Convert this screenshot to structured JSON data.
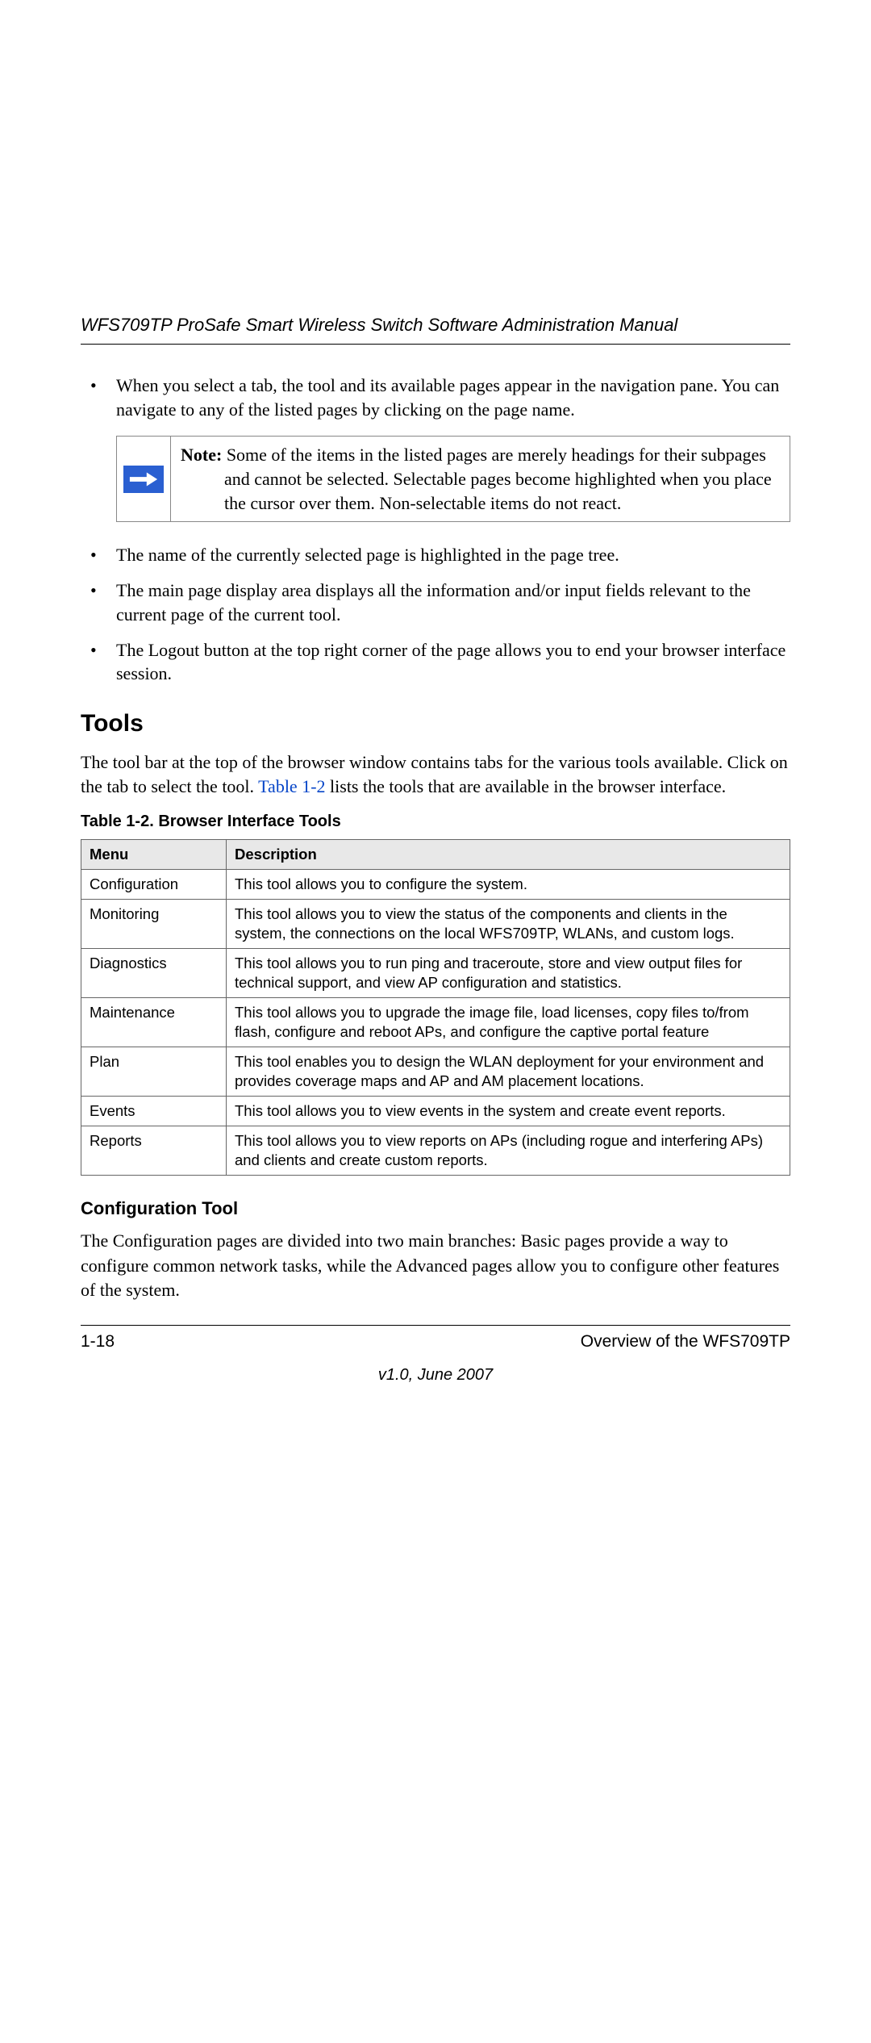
{
  "header": {
    "title": "WFS709TP ProSafe Smart Wireless Switch Software Administration Manual"
  },
  "bullets": {
    "b1": "When you select a tab, the tool and its available pages appear in the navigation pane. You can navigate to any of the listed pages by clicking on the page name.",
    "b2": "The name of the currently selected page is highlighted in the page tree.",
    "b3": "The main page display area displays all the information and/or input fields relevant to the current page of the current tool.",
    "b4": "The Logout button at the top right corner of the page allows you to end your browser interface session."
  },
  "note": {
    "label": "Note:",
    "line1": "Some of the items in the listed pages are merely headings for their subpages",
    "line2": "and cannot be selected. Selectable pages become highlighted when you place the cursor over them. Non-selectable items do not react."
  },
  "tools": {
    "heading": "Tools",
    "intro_a": "The tool bar at the top of the browser window contains tabs for the various tools available. Click on the tab to select the tool. ",
    "intro_link": "Table 1-2",
    "intro_b": " lists the tools that are available in the browser interface.",
    "table_caption": "Table 1-2.   Browser Interface Tools",
    "headers": {
      "menu": "Menu",
      "desc": "Description"
    },
    "rows": [
      {
        "menu": "Configuration",
        "desc": "This tool allows you to configure the system."
      },
      {
        "menu": "Monitoring",
        "desc": "This tool allows you to view the status of the components and clients in the system, the connections on the local WFS709TP, WLANs, and custom logs."
      },
      {
        "menu": "Diagnostics",
        "desc": "This tool allows you to run ping and traceroute, store and view output files for technical support, and view AP configuration and statistics."
      },
      {
        "menu": "Maintenance",
        "desc": "This tool allows you to upgrade the image file, load licenses, copy files to/from flash, configure and reboot APs, and configure the captive portal feature"
      },
      {
        "menu": "Plan",
        "desc": "This tool enables you to design the WLAN deployment for your environment and provides coverage maps and AP and AM placement locations."
      },
      {
        "menu": "Events",
        "desc": "This tool allows you to view events in the system and create event reports."
      },
      {
        "menu": "Reports",
        "desc": "This tool allows you to view reports on APs (including rogue and interfering APs) and clients and create custom reports."
      }
    ]
  },
  "config_tool": {
    "heading": "Configuration Tool",
    "body": "The Configuration pages are divided into two main branches: Basic pages provide a way to configure common network tasks, while the Advanced pages allow you to configure other features of the system."
  },
  "footer": {
    "page_num": "1-18",
    "section": "Overview of the WFS709TP",
    "version": "v1.0, June 2007"
  },
  "chart_data": {
    "type": "table",
    "title": "Table 1-2. Browser Interface Tools",
    "columns": [
      "Menu",
      "Description"
    ],
    "rows": [
      [
        "Configuration",
        "This tool allows you to configure the system."
      ],
      [
        "Monitoring",
        "This tool allows you to view the status of the components and clients in the system, the connections on the local WFS709TP, WLANs, and custom logs."
      ],
      [
        "Diagnostics",
        "This tool allows you to run ping and traceroute, store and view output files for technical support, and view AP configuration and statistics."
      ],
      [
        "Maintenance",
        "This tool allows you to upgrade the image file, load licenses, copy files to/from flash, configure and reboot APs, and configure the captive portal feature"
      ],
      [
        "Plan",
        "This tool enables you to design the WLAN deployment for your environment and provides coverage maps and AP and AM placement locations."
      ],
      [
        "Events",
        "This tool allows you to view events in the system and create event reports."
      ],
      [
        "Reports",
        "This tool allows you to view reports on APs (including rogue and interfering APs) and clients and create custom reports."
      ]
    ]
  }
}
